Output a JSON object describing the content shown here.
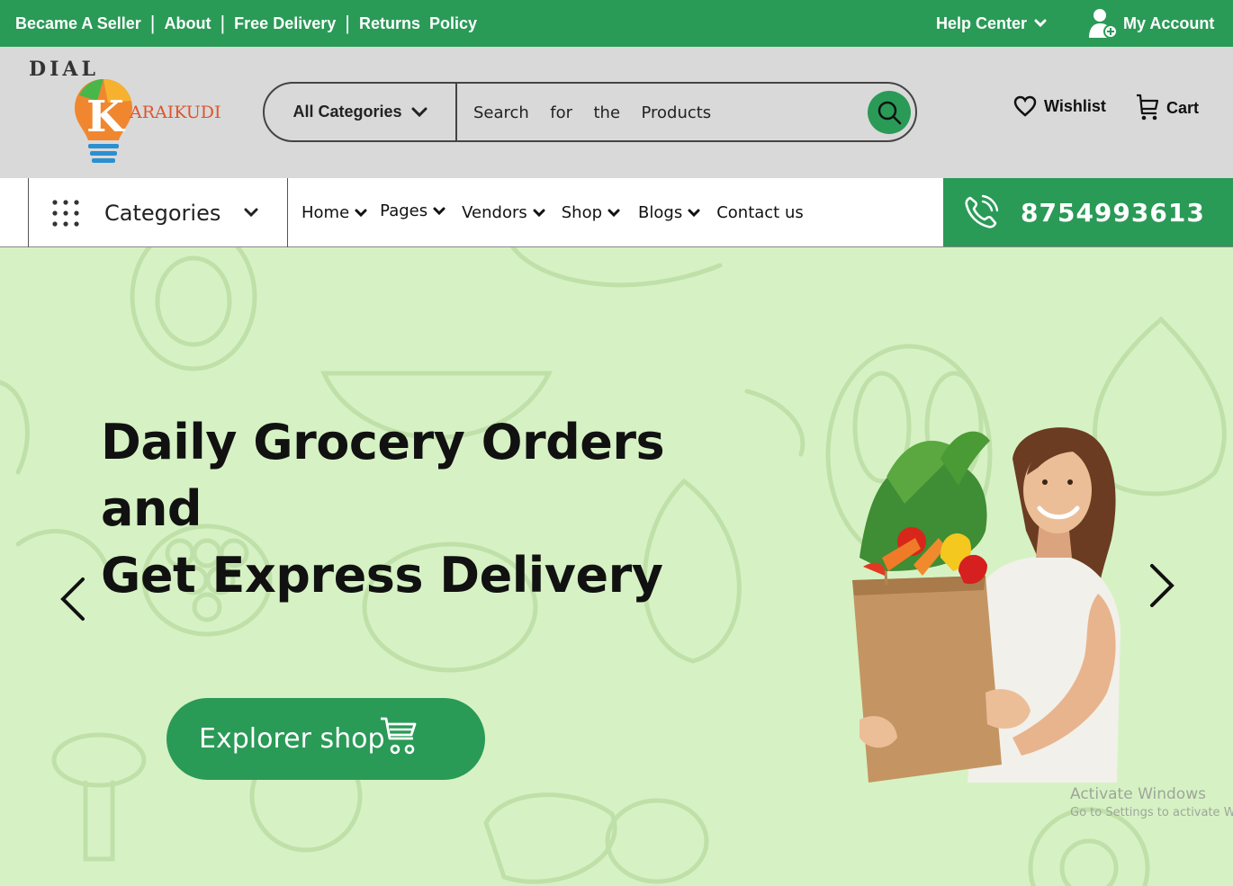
{
  "topbar": {
    "links": [
      "Became A Seller",
      "About",
      "Free Delivery",
      "Returns  Policy"
    ],
    "help_label": "Help Center",
    "account_label": "My Account"
  },
  "brand": {
    "line1": "DIAL",
    "letter": "K",
    "rest": "ARAIKUDI"
  },
  "search": {
    "category_label": "All Categories",
    "placeholder": "Search  for  the  Products"
  },
  "header_actions": {
    "wishlist_label": "Wishlist",
    "cart_label": "Cart"
  },
  "nav": {
    "categories_label": "Categories",
    "items": [
      {
        "label": "Home",
        "has_dropdown": true
      },
      {
        "label": "Pages",
        "has_dropdown": true
      },
      {
        "label": "Vendors",
        "has_dropdown": true
      },
      {
        "label": "Shop",
        "has_dropdown": true
      },
      {
        "label": "Blogs",
        "has_dropdown": true
      },
      {
        "label": "Contact us",
        "has_dropdown": false
      }
    ],
    "phone": "8754993613"
  },
  "hero": {
    "headline_line1": "Daily Grocery Orders and",
    "headline_line2": "Get Express Delivery",
    "cta_label": "Explorer shop"
  },
  "watermark": {
    "title": "Activate Windows",
    "subtitle": "Go to Settings to activate Windows."
  },
  "colors": {
    "brand_green": "#2a9a57",
    "hero_bg": "#d6f2c4",
    "header_gray": "#d9d9d9"
  },
  "icons": [
    "user-icon",
    "chevron-down-icon",
    "search-icon",
    "heart-icon",
    "cart-icon",
    "grid-icon",
    "phone-icon",
    "arrow-left-icon",
    "arrow-right-icon",
    "shopping-cart-icon"
  ]
}
